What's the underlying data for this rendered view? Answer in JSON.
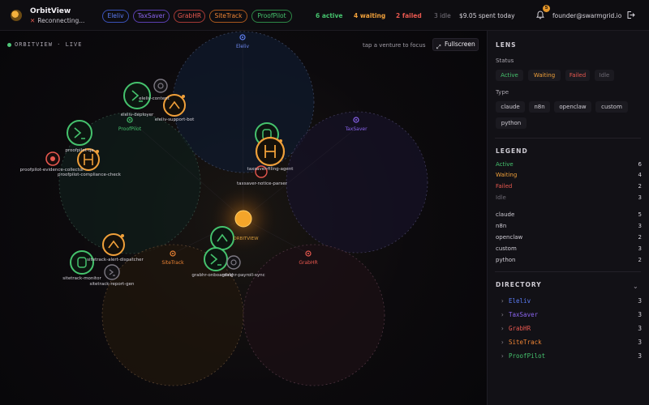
{
  "header": {
    "app_name": "OrbitView",
    "connection_status": "Reconnecting...",
    "ventures": [
      {
        "label": "Eleliv",
        "color": "#4d6ef0"
      },
      {
        "label": "TaxSaver",
        "color": "#7a56e8"
      },
      {
        "label": "GrabHR",
        "color": "#e0554e"
      },
      {
        "label": "SiteTrack",
        "color": "#e8782a"
      },
      {
        "label": "ProofPilot",
        "color": "#3fb65f"
      }
    ],
    "stats": {
      "active": "6 active",
      "waiting": "4 waiting",
      "failed": "2 failed",
      "idle": "3 idle"
    },
    "spend": "$9.05 spent today",
    "notification_count": "5",
    "user_email": "founder@swarmgrid.io"
  },
  "map": {
    "title": "ORBITVIEW · LIVE",
    "hint": "tap a venture to focus",
    "fullscreen_label": "Fullscreen",
    "center_label": "ORBITVIEW",
    "ventures": [
      {
        "name": "Eleliv",
        "color": "#4d6ef0"
      },
      {
        "name": "TaxSaver",
        "color": "#7a56e8"
      },
      {
        "name": "GrabHR",
        "color": "#e0554e"
      },
      {
        "name": "SiteTrack",
        "color": "#e8782a"
      },
      {
        "name": "ProofPilot",
        "color": "#3fb65f"
      }
    ],
    "agents": [
      "eleliv-content",
      "eleliv-deployer",
      "eleliv-support-bot",
      "proofpilot-qa",
      "proofpilot-evidence-collector",
      "proofpilot-compliance-check",
      "taxsaver-filing-agent",
      "taxsaver-notice-parser",
      "sitetrack-alert-dispatcher",
      "sitetrack-monitor",
      "sitetrack-report-gen",
      "grabhr-onboarding",
      "grabhr-payroll-sync"
    ]
  },
  "lens": {
    "title": "LENS",
    "status_label": "Status",
    "status_filters": [
      {
        "label": "Active",
        "color": "#45c26d"
      },
      {
        "label": "Waiting",
        "color": "#f0a03a"
      },
      {
        "label": "Failed",
        "color": "#e8584f"
      },
      {
        "label": "Idle",
        "color": "#6e6a74"
      }
    ],
    "type_label": "Type",
    "type_filters": [
      "claude",
      "n8n",
      "openclaw",
      "custom",
      "python"
    ]
  },
  "legend": {
    "title": "LEGEND",
    "status_rows": [
      {
        "label": "Active",
        "count": "6",
        "color": "#45c26d"
      },
      {
        "label": "Waiting",
        "count": "4",
        "color": "#f0a03a"
      },
      {
        "label": "Failed",
        "count": "2",
        "color": "#e8584f"
      },
      {
        "label": "Idle",
        "count": "3",
        "color": "#6e6a74"
      }
    ],
    "type_rows": [
      {
        "label": "claude",
        "count": "5"
      },
      {
        "label": "n8n",
        "count": "3"
      },
      {
        "label": "openclaw",
        "count": "2"
      },
      {
        "label": "custom",
        "count": "3"
      },
      {
        "label": "python",
        "count": "2"
      }
    ]
  },
  "directory": {
    "title": "DIRECTORY",
    "rows": [
      {
        "label": "Eleliv",
        "count": "3",
        "color": "#5b7cf5"
      },
      {
        "label": "TaxSaver",
        "count": "3",
        "color": "#8a64ee"
      },
      {
        "label": "GrabHR",
        "count": "3",
        "color": "#e8584f"
      },
      {
        "label": "SiteTrack",
        "count": "3",
        "color": "#ee8434"
      },
      {
        "label": "ProofPilot",
        "count": "3",
        "color": "#45c26d"
      }
    ]
  }
}
